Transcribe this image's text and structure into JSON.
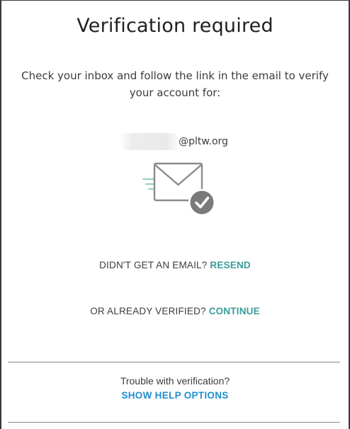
{
  "dialog": {
    "title": "Verification required",
    "message": "Check your inbox and follow the link in the email to verify your account for:",
    "email_domain": "@pltw.org"
  },
  "icons": {
    "envelope": "envelope-check-icon"
  },
  "resend": {
    "prompt": "DIDN'T GET AN EMAIL?",
    "link_label": "RESEND"
  },
  "continue": {
    "prompt": "OR ALREADY VERIFIED?",
    "link_label": "CONTINUE"
  },
  "help": {
    "prompt": "Trouble with verification?",
    "link_label": "SHOW HELP OPTIONS"
  },
  "colors": {
    "accent_teal": "#3a9c9a",
    "link_blue": "#1e8fd0",
    "check_badge": "#7a7a7a"
  }
}
